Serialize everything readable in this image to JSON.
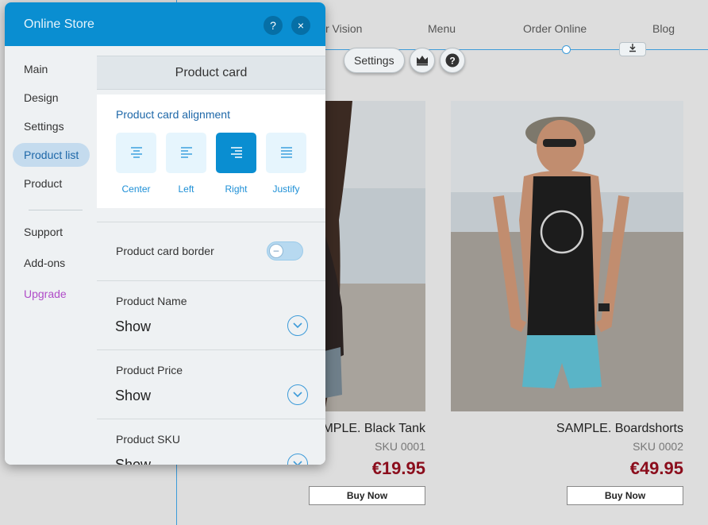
{
  "site": {
    "nav": [
      "r Vision",
      "Menu",
      "Order Online",
      "Blog"
    ],
    "download_icon": "download-icon",
    "floating_bar": {
      "settings_label": "Settings",
      "crown_icon": "crown-icon",
      "help_icon": "help-icon"
    },
    "products": [
      {
        "name": "MPLE. Black Tank",
        "sku": "SKU 0001",
        "price": "€19.95",
        "buy_label": "Buy Now"
      },
      {
        "name": "SAMPLE. Boardshorts",
        "sku": "SKU 0002",
        "price": "€49.95",
        "buy_label": "Buy Now"
      }
    ]
  },
  "panel": {
    "title": "Online Store",
    "help_label": "?",
    "close_label": "×",
    "sidebar": {
      "items": [
        {
          "label": "Main",
          "active": false
        },
        {
          "label": "Design",
          "active": false
        },
        {
          "label": "Settings",
          "active": false
        },
        {
          "label": "Product list",
          "active": true
        },
        {
          "label": "Product",
          "active": false
        }
      ],
      "bottom_items": [
        {
          "label": "Support"
        },
        {
          "label": "Add-ons"
        },
        {
          "label": "Upgrade"
        }
      ]
    },
    "section_title": "Product card",
    "alignment": {
      "label": "Product card alignment",
      "options": [
        {
          "label": "Center",
          "selected": false
        },
        {
          "label": "Left",
          "selected": false
        },
        {
          "label": "Right",
          "selected": true
        },
        {
          "label": "Justify",
          "selected": false
        }
      ]
    },
    "border": {
      "label": "Product card border",
      "enabled": false,
      "knob_label": "–"
    },
    "fields": [
      {
        "label": "Product Name",
        "value": "Show"
      },
      {
        "label": "Product Price",
        "value": "Show"
      },
      {
        "label": "Product SKU",
        "value": "Show"
      }
    ]
  },
  "colors": {
    "accent": "#0a8ed1",
    "price": "#8b0d1c",
    "upgrade": "#b04cc8"
  }
}
